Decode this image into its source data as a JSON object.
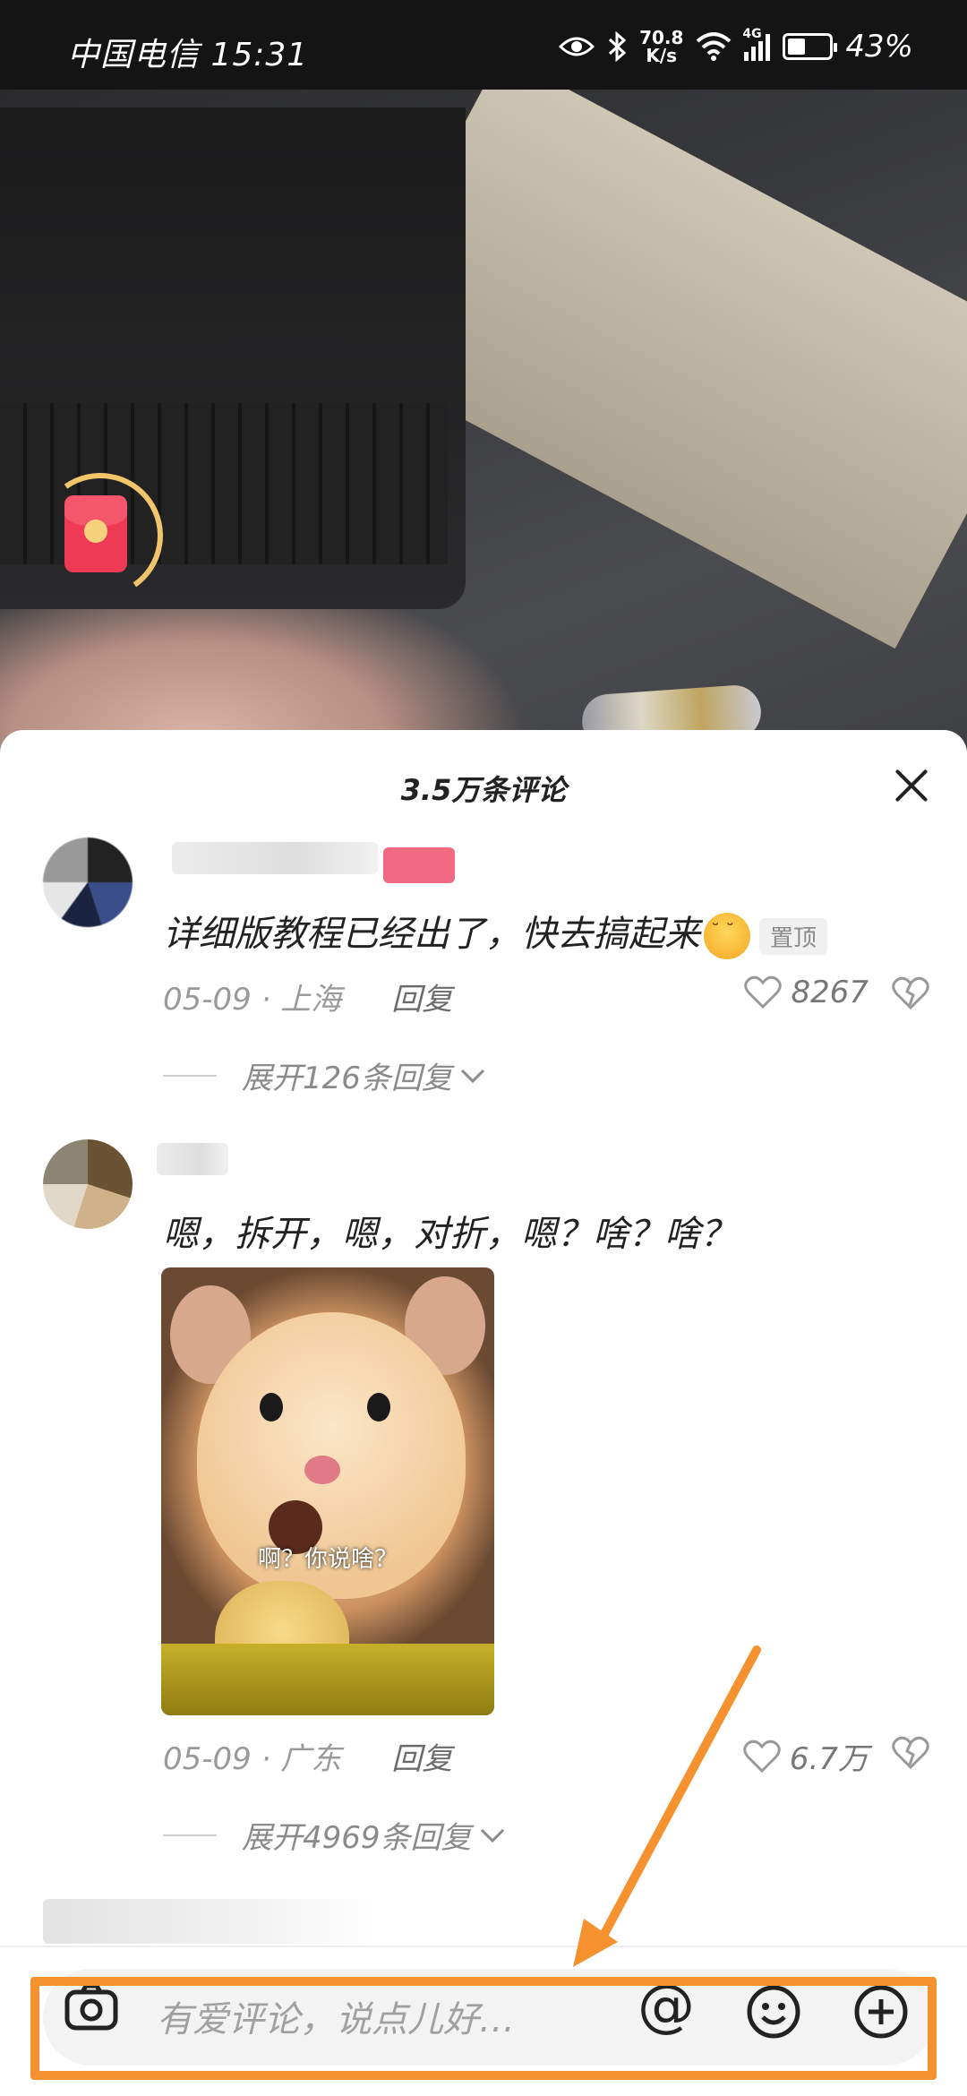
{
  "status_bar": {
    "carrier_time": "中国电信 15:31",
    "network_speed_value": "70.8",
    "network_speed_unit": "K/s",
    "signal_label": "4G",
    "battery": "43%",
    "battery_level": 0.43
  },
  "comments_panel": {
    "title": "3.5万条评论"
  },
  "comments": [
    {
      "text": "详细版教程已经出了，快去搞起来",
      "pin_label": "置顶",
      "date_location": "05-09 · 上海",
      "reply_label": "回复",
      "likes": "8267",
      "expand_label": "展开126条回复"
    },
    {
      "text": "嗯，拆开，嗯，对折，嗯？啥？啥？",
      "image_caption": "啊？你说啥？",
      "date_location": "05-09 · 广东",
      "reply_label": "回复",
      "likes": "6.7万",
      "expand_label": "展开4969条回复"
    }
  ],
  "input_bar": {
    "placeholder": "有爱评论，说点儿好…",
    "at_symbol": "@"
  },
  "annotation_color": "#f5922f"
}
